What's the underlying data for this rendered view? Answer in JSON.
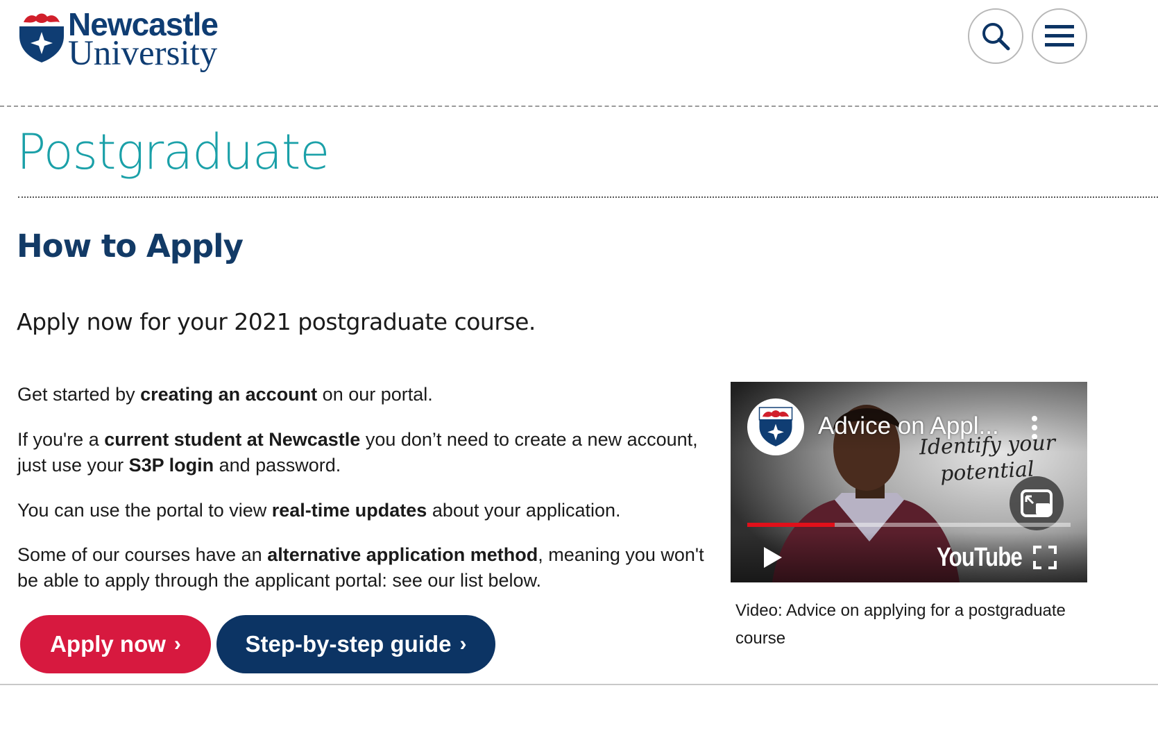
{
  "header": {
    "logo_line1": "Newcastle",
    "logo_line2": "University",
    "search_icon": "search-icon",
    "menu_icon": "hamburger-menu-icon"
  },
  "section_title": "Postgraduate",
  "page_heading": "How to Apply",
  "lead": "Apply now for your 2021 postgraduate course.",
  "paragraphs": {
    "p1": {
      "a": "Get started by ",
      "b": "creating an account",
      "c": " on our portal."
    },
    "p2": {
      "a": "If you're a ",
      "b": "current student at Newcastle",
      "c": " you don’t need to create a new account, just use your ",
      "d": "S3P login",
      "e": " and password."
    },
    "p3": {
      "a": "You can use the portal to view ",
      "b": "real-time updates",
      "c": " about your application."
    },
    "p4": {
      "a": "Some of our courses have an ",
      "b": "alternative application method",
      "c": ", meaning you won't be able to apply through the applicant portal: see our list below."
    }
  },
  "buttons": {
    "apply_label": "Apply now",
    "guide_label": "Step-by-step guide",
    "chevron": "›"
  },
  "video": {
    "title": "Advice on Appl...",
    "handwriting_line1": "Identify your",
    "handwriting_line2": "potential",
    "platform_label": "YouTube",
    "progress": 0.27,
    "caption": "Video: Advice on applying for a postgraduate course"
  },
  "colors": {
    "brand_navy": "#0c3464",
    "accent_teal": "#1aa0a8",
    "apply_red": "#d7193f",
    "progress_red": "#e0101a"
  }
}
